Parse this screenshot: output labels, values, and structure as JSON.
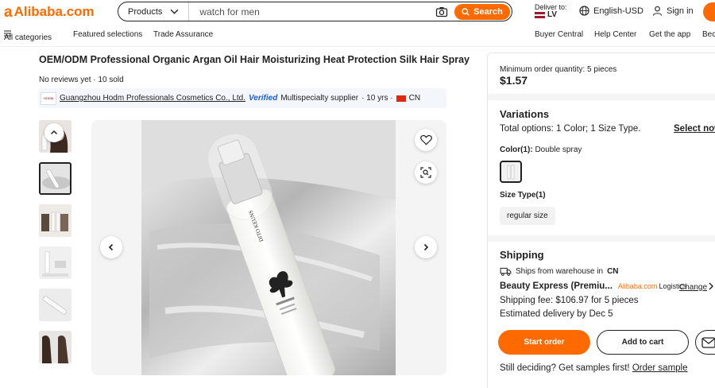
{
  "header": {
    "logo_text": "Alibaba.com",
    "search": {
      "category_label": "Products",
      "placeholder": "watch for men",
      "button_label": "Search"
    },
    "deliver": {
      "label": "Deliver to:",
      "country": "LV"
    },
    "language_currency": "English-USD",
    "sign_in": "Sign in",
    "brand_color": "#ff6a00"
  },
  "nav": {
    "all_categories": "All categories",
    "featured": "Featured selections",
    "trade_assurance": "Trade Assurance",
    "buyer_central": "Buyer Central",
    "help_center": "Help Center",
    "get_app": "Get the app",
    "become": "Bec"
  },
  "product": {
    "title": "OEM/ODM Professional Organic Argan Oil Hair Moisturizing Heat Protection Silk Hair Spray",
    "reviews": "No reviews yet · 10 sold",
    "image_brand_text": "DITO KEUNS"
  },
  "supplier": {
    "name": "Guangzhou Hodm Professionals Cosmetics Co., Ltd.",
    "verified": "Verified",
    "type": "Multispecialty supplier",
    "years": "· 10 yrs ·",
    "country": "CN"
  },
  "purchase": {
    "moq": "Minimum order quantity: 5 pieces",
    "price": "$1.57"
  },
  "variations": {
    "heading": "Variations",
    "total_options": "Total options: 1 Color; 1 Size Type.",
    "select_now": "Select now",
    "color_label": "Color(1):",
    "color_value": "Double spray",
    "size_label": "Size Type(1)",
    "size_value": "regular size"
  },
  "shipping": {
    "heading": "Shipping",
    "ships_from": "Ships from warehouse in",
    "ships_from_country": "CN",
    "carrier": "Beauty Express (Premiu...",
    "carrier_brand": "Alibaba.com",
    "carrier_suffix": "Logistics",
    "change": "Change",
    "fee": "Shipping fee: $106.97 for 5 pieces",
    "eta": "Estimated delivery by Dec 5"
  },
  "actions": {
    "start_order": "Start order",
    "add_to_cart": "Add to cart",
    "samples_text": "Still deciding? Get samples first!",
    "order_sample": "Order sample"
  }
}
